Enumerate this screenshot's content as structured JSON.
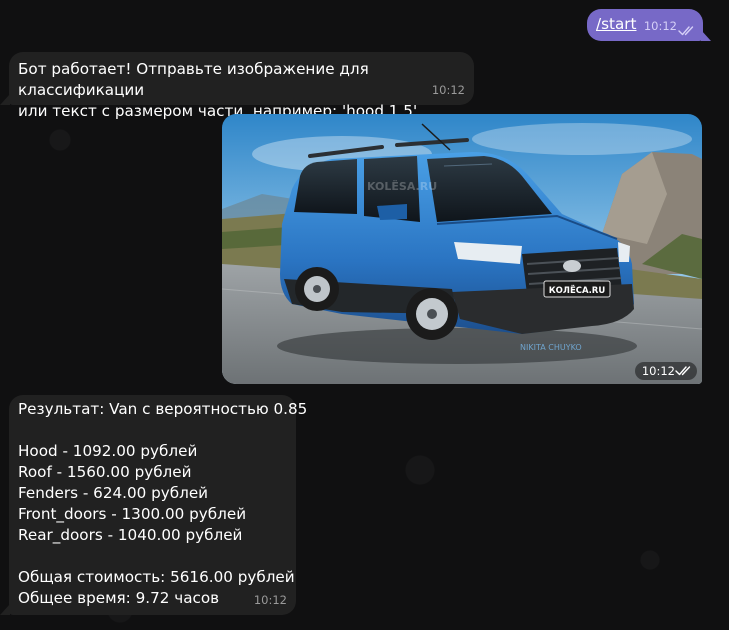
{
  "messages": {
    "command": {
      "text": "/start",
      "time": "10:12"
    },
    "bot_reply": {
      "text": "Бот работает! Отправьте изображение для классификации\nили текст с размером части, например: 'hood 1.5'.",
      "time": "10:12"
    },
    "photo": {
      "time": "10:12",
      "watermark": "KOLЁSA.RU",
      "plate": "КОЛЁСА.RU",
      "signature": "NIKITA CHUYKO"
    },
    "result": {
      "title": "Результат: Van с вероятностью 0.85",
      "items": [
        "Hood - 1092.00 рублей",
        "Roof - 1560.00 рублей",
        "Fenders - 624.00 рублей",
        "Front_doors - 1300.00 рублей",
        "Rear_doors - 1040.00 рублей"
      ],
      "total": "Общая стоимость: 5616.00 рублей",
      "duration": "Общее время: 9.72 часов",
      "time": "10:12"
    }
  },
  "colors": {
    "background": "#101011",
    "outgoing_bubble": "#7769c7",
    "incoming_bubble": "#212121",
    "car_body": "#2f7fd0"
  },
  "icons": {
    "read_receipt": "double-check-icon"
  }
}
